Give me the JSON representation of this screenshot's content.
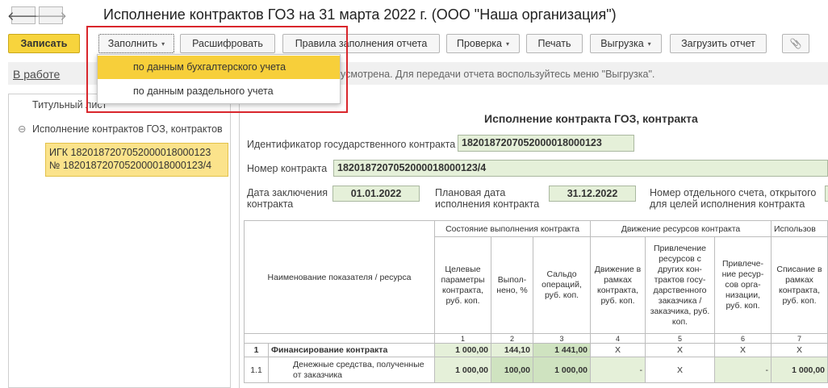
{
  "window": {
    "title": "Исполнение контрактов ГОЗ на 31 марта 2022 г. (ООО \"Наша организация\")"
  },
  "nav": {
    "back_icon": "arrow-left-icon",
    "forward_icon": "arrow-right-icon",
    "back": "🡐",
    "forward": "🡒"
  },
  "toolbar": {
    "save": "Записать",
    "fill": "Заполнить",
    "decode": "Расшифровать",
    "rules": "Правила заполнения отчета",
    "check": "Проверка",
    "print": "Печать",
    "export": "Выгрузка",
    "upload": "Загрузить отчет",
    "attach_icon": "paperclip-icon",
    "attach_glyph": "📎",
    "caret": "▾"
  },
  "status": {
    "state_link": "В работе",
    "message": "усмотрена. Для передачи отчета воспользуйтесь меню \"Выгрузка\"."
  },
  "fill_menu": {
    "items": [
      "по данным бухгалтерского учета",
      "по данным раздельного учета"
    ],
    "active_index": 0
  },
  "sidebar": {
    "title_sheet": "Титульный лист",
    "section": "Исполнение контрактов ГОЗ, контрактов",
    "collapse_glyph": "⊖",
    "selected_item": "ИГК 1820187207052000018000123 № 1820187207052000018000123/4"
  },
  "form": {
    "title": "Исполнение контракта ГОЗ, контракта",
    "contract_id_label": "Идентификатор государственного контракта",
    "contract_id": "1820187207052000018000123",
    "contract_number_label": "Номер контракта",
    "contract_number": "1820187207052000018000123/4",
    "conclusion_date_label": "Дата заключения\nконтракта",
    "conclusion_date": "01.01.2022",
    "planned_date_label": "Плановая дата\nисполнения контракта",
    "planned_date": "31.12.2022",
    "account_label": "Номер отдельного счета, открытого\nдля целей исполнения контракта"
  },
  "table": {
    "group_headers": [
      "Состояние выполнения контракта",
      "Движение ресурсов контракта",
      "Использов"
    ],
    "name_header": "Наименование показателя / ресурса",
    "columns": [
      "Целевые параметры контракта, руб. коп.",
      "Выпол-нено, %",
      "Сальдо операций, руб. коп.",
      "Движение в рамках контракта, руб. коп.",
      "Привлечение ресурсов с других кон-трактов госу-дарственного заказчика / заказчика, руб. коп.",
      "Привлече-ние ресур-сов орга-низации, руб. коп.",
      "Списание в рамках контракта, руб. коп."
    ],
    "column_numbers": [
      "1",
      "2",
      "3",
      "4",
      "5",
      "6",
      "7"
    ],
    "rows": [
      {
        "code": "1",
        "name": "Финансирование контракта",
        "c1": "1 000,00",
        "c2": "144,10",
        "c3": "1 441,00",
        "c4": "X",
        "c5": "X",
        "c6": "X",
        "c7": "X"
      },
      {
        "code": "1.1",
        "name": "Денежные средства, полученные от заказчика",
        "c1": "1 000,00",
        "c2": "100,00",
        "c3": "1 000,00",
        "c4": "-",
        "c5": "X",
        "c6": "-",
        "c7": "1 000,00"
      }
    ]
  }
}
